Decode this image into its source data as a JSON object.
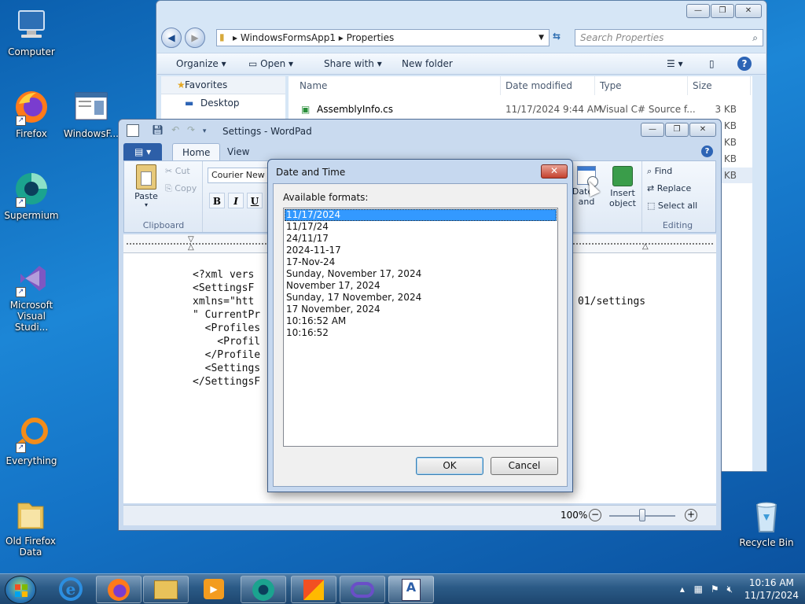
{
  "desktop": {
    "icons": [
      {
        "label": "Computer"
      },
      {
        "label": "Firefox"
      },
      {
        "label": "WindowsF..."
      },
      {
        "label": "Supermium"
      },
      {
        "label": "Microsoft Visual Studi..."
      },
      {
        "label": "Everything"
      },
      {
        "label": "Old Firefox Data"
      },
      {
        "label": "Recycle Bin"
      }
    ]
  },
  "explorer": {
    "breadcrumb": [
      "WindowsFormsApp1",
      "Properties"
    ],
    "search_placeholder": "Search Properties",
    "toolbar": {
      "organize": "Organize",
      "open": "Open",
      "share": "Share with",
      "new_folder": "New folder"
    },
    "nav": {
      "favorites": "Favorites",
      "desktop": "Desktop"
    },
    "columns": {
      "name": "Name",
      "date": "Date modified",
      "type": "Type",
      "size": "Size"
    },
    "files": [
      {
        "name": "AssemblyInfo.cs",
        "date": "11/17/2024 9:44 AM",
        "type": "Visual C# Source f...",
        "size": "3 KB"
      }
    ],
    "extra_sizes": [
      "4 KB",
      "6 KB",
      "2 KB",
      "1 KB"
    ]
  },
  "wordpad": {
    "title": "Settings - WordPad",
    "tabs": {
      "home": "Home",
      "view": "View"
    },
    "clipboard": {
      "paste": "Paste",
      "cut": "Cut",
      "copy": "Copy",
      "group": "Clipboard"
    },
    "font": {
      "name": "Courier New",
      "bold": "B",
      "italic": "I",
      "underline": "U"
    },
    "insert": {
      "datetime": "Date and time",
      "object_line1": "Insert",
      "object_line2": "object"
    },
    "editing": {
      "find": "Find",
      "replace": "Replace",
      "select_all": "Select all",
      "group": "Editing"
    },
    "doc_lines": [
      "<?xml vers",
      "<SettingsF",
      "xmlns=\"htt",
      "\" CurrentPr",
      "  <Profiles",
      "    <Profil",
      "  </Profile",
      "  <Settings",
      "</SettingsF"
    ],
    "doc_right_text": "01/settings",
    "zoom": "100%"
  },
  "dialog": {
    "title": "Date and Time",
    "label": "Available formats:",
    "formats": [
      "11/17/2024",
      "11/17/24",
      "24/11/17",
      "2024-11-17",
      "17-Nov-24",
      "Sunday, November 17, 2024",
      "November 17, 2024",
      "Sunday, 17 November, 2024",
      "17 November, 2024",
      "10:16:52 AM",
      "10:16:52"
    ],
    "selected_index": 0,
    "ok": "OK",
    "cancel": "Cancel"
  },
  "taskbar": {
    "time": "10:16 AM",
    "date": "11/17/2024"
  }
}
